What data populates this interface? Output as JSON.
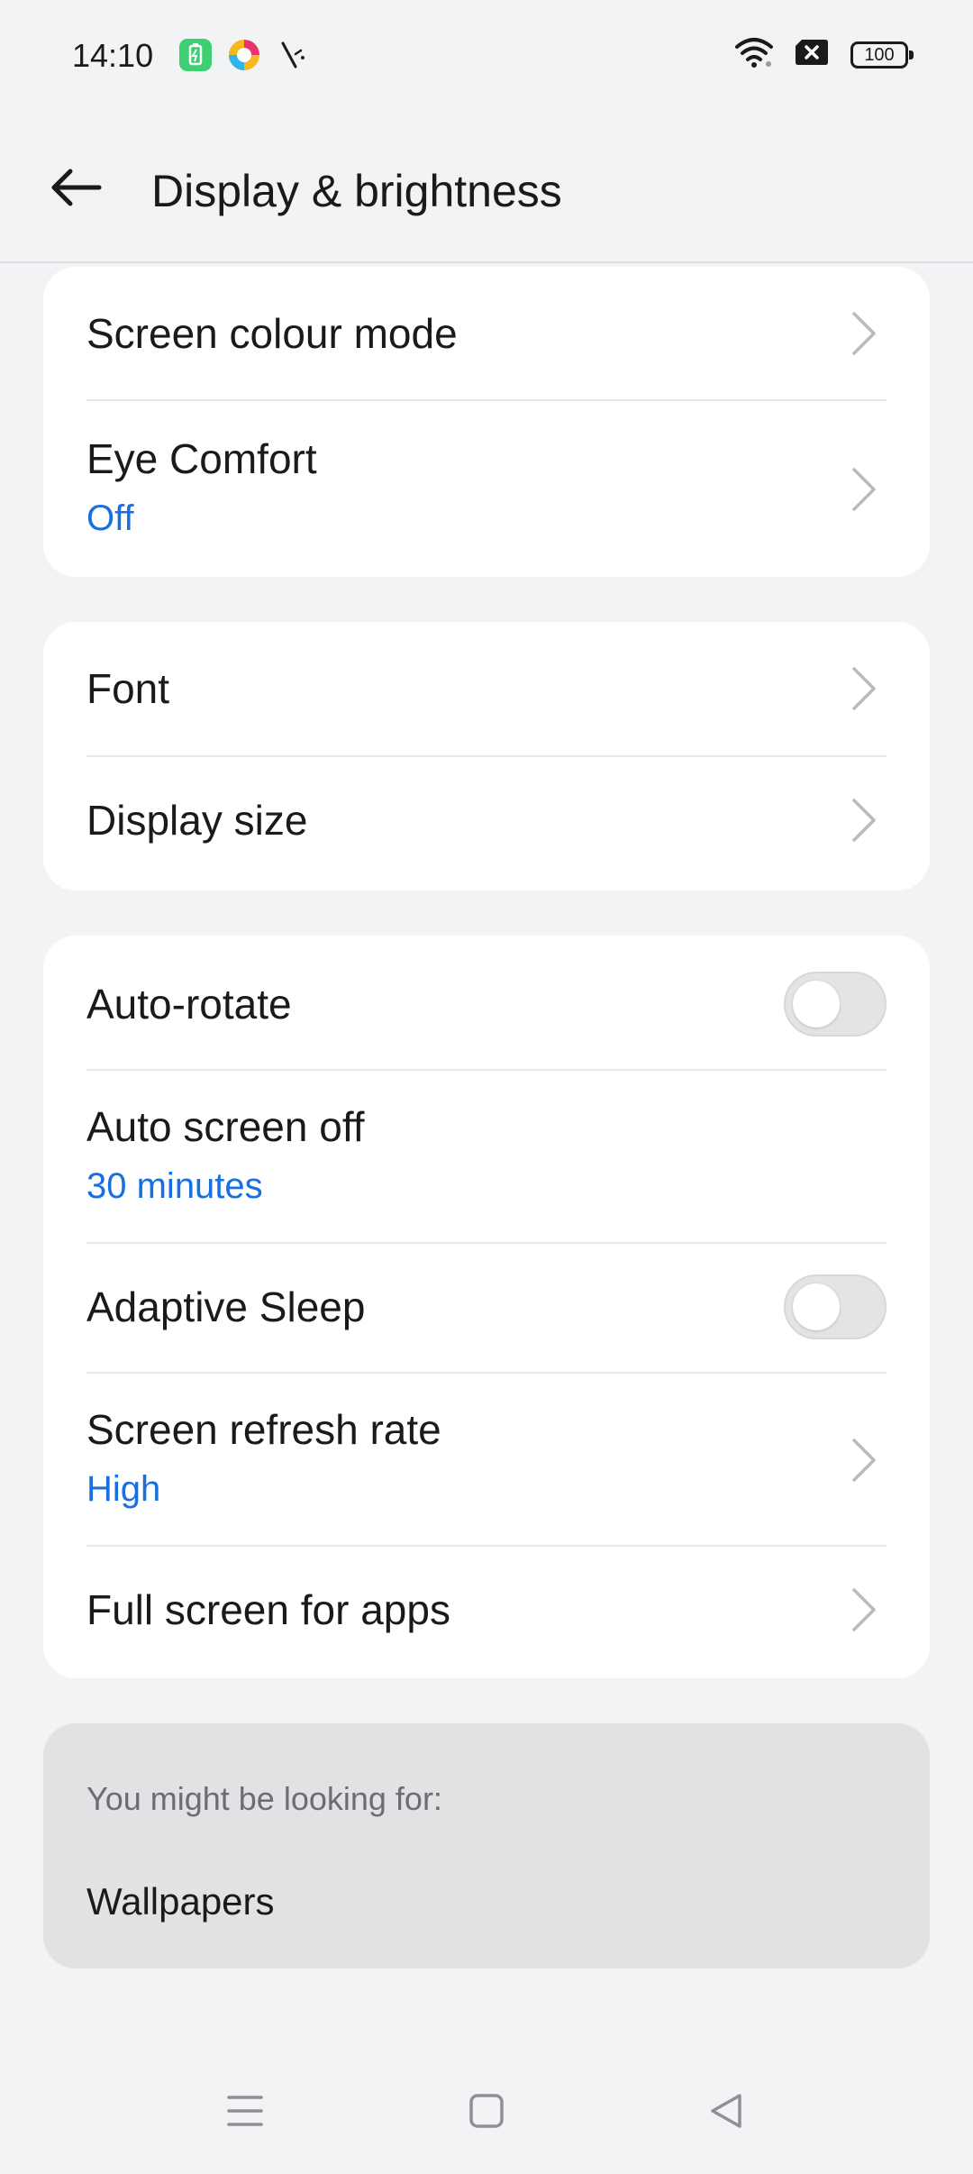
{
  "status_bar": {
    "time": "14:10",
    "battery": "100",
    "left_icons": [
      "battery-saver-icon",
      "browser-app-icon",
      "feather-icon"
    ],
    "right_icons": [
      "wifi-icon",
      "no-sim-icon",
      "battery-icon"
    ]
  },
  "header": {
    "title": "Display & brightness",
    "back_icon": "back-arrow-icon"
  },
  "sections": [
    {
      "items": [
        {
          "title": "Screen colour mode",
          "control": "chevron"
        },
        {
          "title": "Eye Comfort",
          "subtitle": "Off",
          "control": "chevron"
        }
      ]
    },
    {
      "items": [
        {
          "title": "Font",
          "control": "chevron"
        },
        {
          "title": "Display size",
          "control": "chevron"
        }
      ]
    },
    {
      "items": [
        {
          "title": "Auto-rotate",
          "control": "toggle",
          "toggle_on": false
        },
        {
          "title": "Auto screen off",
          "subtitle": "30 minutes",
          "control": "none"
        },
        {
          "title": "Adaptive Sleep",
          "control": "toggle",
          "toggle_on": false
        },
        {
          "title": "Screen refresh rate",
          "subtitle": "High",
          "control": "chevron"
        },
        {
          "title": "Full screen for apps",
          "control": "chevron"
        }
      ]
    }
  ],
  "suggestions": {
    "heading": "You might be looking for:",
    "items": [
      "Wallpapers"
    ]
  },
  "nav_bar": {
    "icons": [
      "menu-icon",
      "home-icon",
      "back-icon"
    ]
  },
  "colors": {
    "accent": "#1a6fe0",
    "background": "#f2f3f5",
    "card": "#ffffff",
    "suggestion_card": "#e1e2e4",
    "toggle_off": "#e3e4e6"
  }
}
